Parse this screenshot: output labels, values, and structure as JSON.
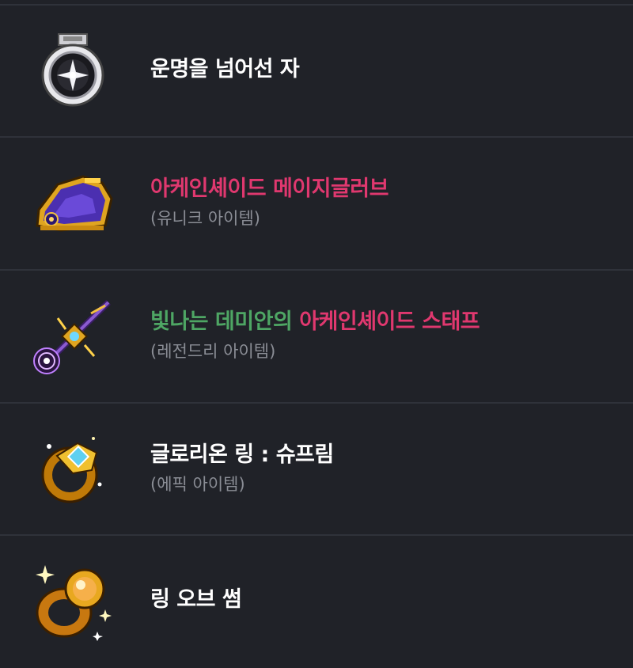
{
  "items": [
    {
      "name": "운명을 넘어선 자",
      "icon": "destiny-medal-icon",
      "color": "#ffffff"
    },
    {
      "name": "아케인셰이드 메이지글러브",
      "grade": "(유니크 아이템)",
      "icon": "arcane-glove-icon",
      "color": "#e0386f"
    },
    {
      "prefix": "빛나는 데미안의",
      "name": "아케인셰이드 스태프",
      "grade": "(레전드리 아이템)",
      "icon": "arcane-staff-icon",
      "prefix_color": "#4ea664",
      "color": "#e0386f"
    },
    {
      "name": "글로리온 링 : 슈프림",
      "grade": "(에픽 아이템)",
      "icon": "glorion-ring-icon",
      "color": "#ffffff"
    },
    {
      "name": "링 오브 썸",
      "icon": "ring-of-some-icon",
      "color": "#ffffff"
    }
  ]
}
